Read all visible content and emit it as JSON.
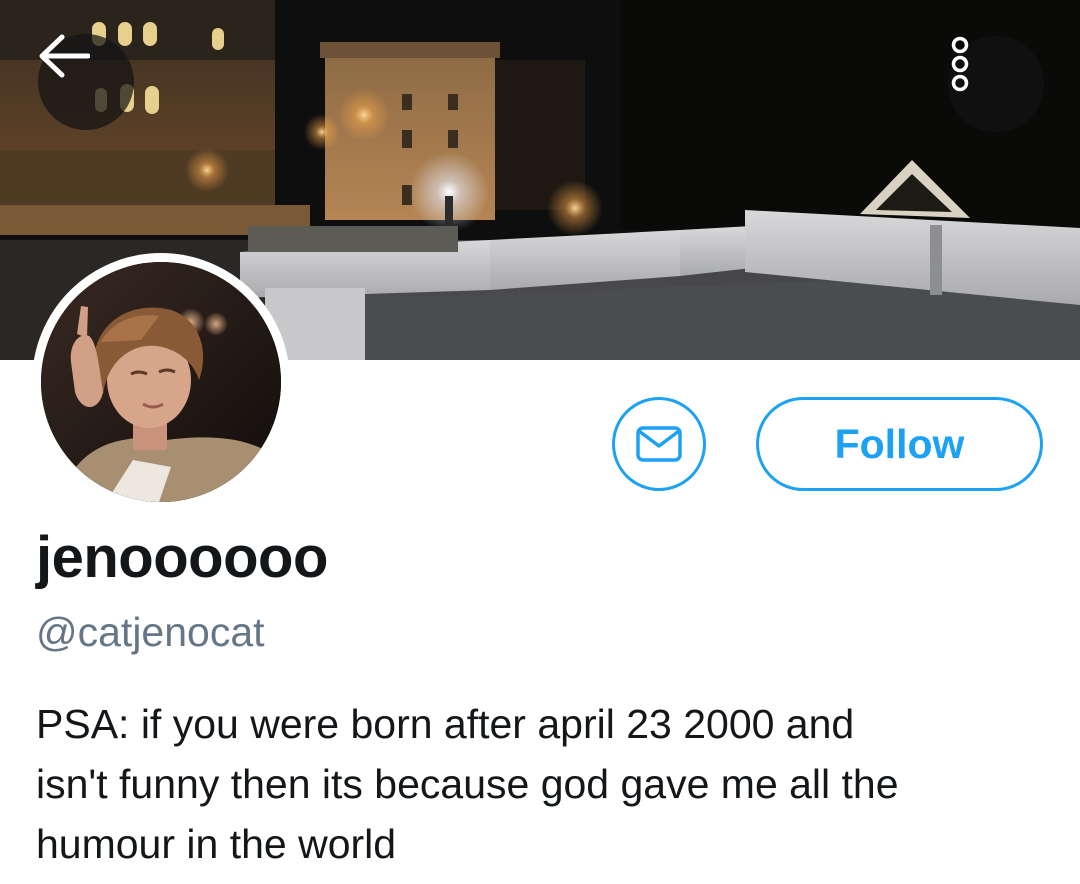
{
  "header": {
    "back_icon": "arrow-left-icon",
    "more_icon": "more-vertical-dots-icon"
  },
  "profile": {
    "display_name": "jenoooooo",
    "handle": "@catjenocat",
    "bio_lines": [
      "PSA: if you were born after april 23 2000 and",
      "isn't funny then its because god gave me all the",
      "humour in the world"
    ]
  },
  "actions": {
    "message_icon": "envelope-icon",
    "follow_label": "Follow"
  },
  "colors": {
    "accent": "#1da1f2",
    "name_text": "#14171a",
    "handle_text": "#657786"
  }
}
